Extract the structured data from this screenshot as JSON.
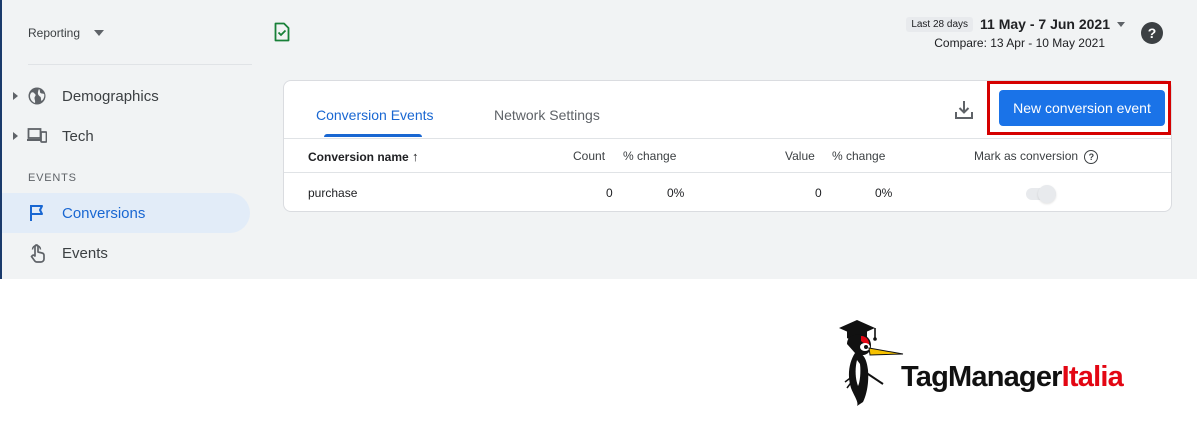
{
  "sidebar": {
    "reporting_label": "Reporting",
    "items": [
      {
        "label": "Demographics",
        "icon": "globe-icon"
      },
      {
        "label": "Tech",
        "icon": "devices-icon"
      }
    ],
    "section_label": "EVENTS",
    "event_items": [
      {
        "label": "Conversions",
        "icon": "flag-icon",
        "active": true
      },
      {
        "label": "Events",
        "icon": "touch-icon"
      }
    ]
  },
  "header": {
    "period_badge": "Last 28 days",
    "date_range": "11 May - 7 Jun 2021",
    "compare": "Compare: 13 Apr - 10 May 2021"
  },
  "card": {
    "tabs": [
      "Conversion Events",
      "Network Settings"
    ],
    "new_button": "New conversion event",
    "columns": {
      "name": "Conversion name",
      "sort_arrow": "↑",
      "count": "Count",
      "count_change": "% change",
      "value": "Value",
      "value_change": "% change",
      "mark": "Mark as conversion",
      "mark_help": "?"
    },
    "rows": [
      {
        "name": "purchase",
        "count": "0",
        "count_change": "0%",
        "value": "0",
        "value_change": "0%",
        "marked": true
      }
    ]
  },
  "brand": {
    "part1": "TagManager",
    "part2": "Italia"
  },
  "colors": {
    "accent": "#1a73e8",
    "active_bg": "#e2ecf8",
    "highlight": "#d50000",
    "brand_red": "#e30613"
  }
}
